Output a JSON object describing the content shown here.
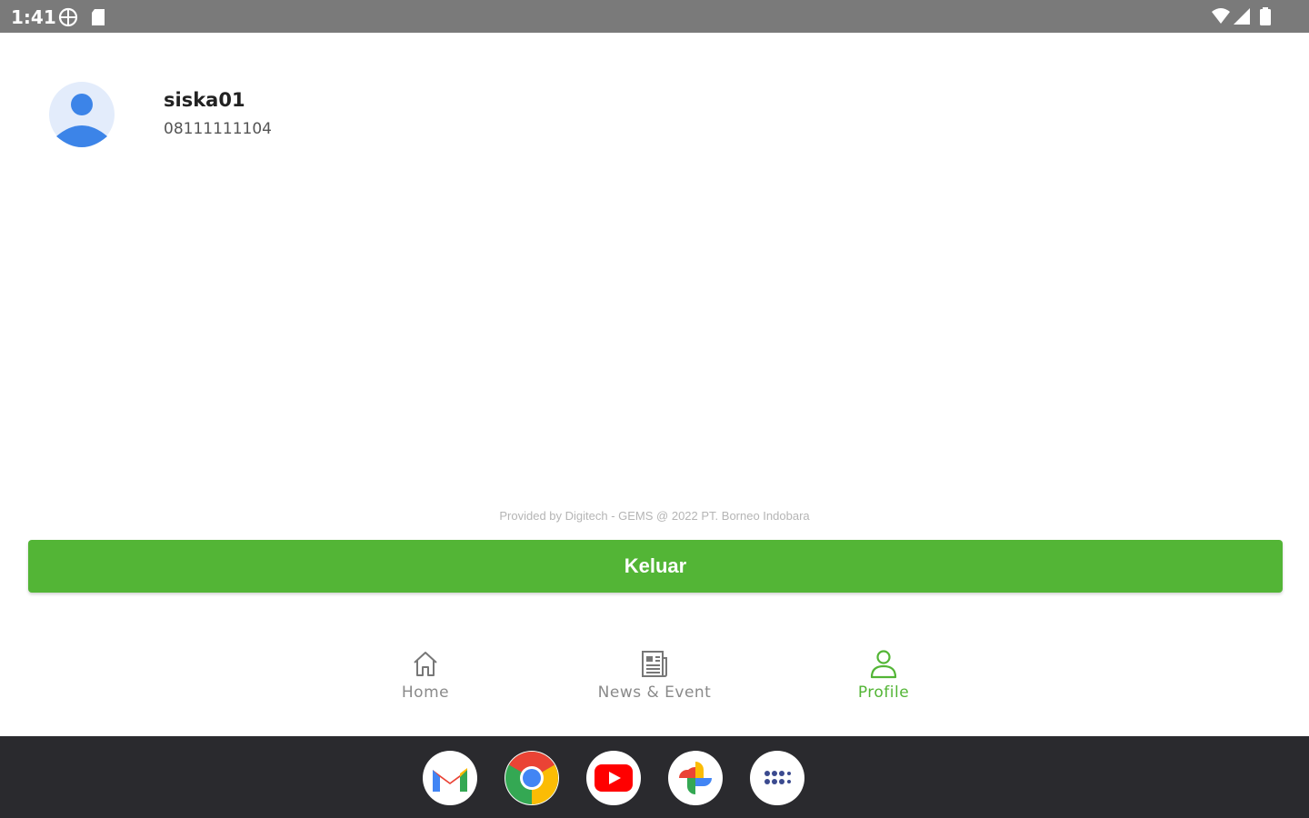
{
  "status_bar": {
    "time": "1:41",
    "icons": [
      "vpn-globe-icon",
      "sd-card-icon",
      "wifi-icon",
      "signal-icon",
      "battery-icon"
    ]
  },
  "profile": {
    "username": "siska01",
    "phone": "08111111104",
    "avatar_icon": "person-avatar-icon"
  },
  "footer": {
    "credit": "Provided by Digitech - GEMS @ 2022 PT. Borneo Indobara"
  },
  "actions": {
    "logout_label": "Keluar"
  },
  "bottom_nav": {
    "items": [
      {
        "label": "Home",
        "icon": "home-icon",
        "active": false
      },
      {
        "label": "News & Event",
        "icon": "newspaper-icon",
        "active": false
      },
      {
        "label": "Profile",
        "icon": "person-icon",
        "active": true
      }
    ]
  },
  "dock": {
    "apps": [
      "gmail-icon",
      "chrome-icon",
      "youtube-icon",
      "photos-icon",
      "app-drawer-icon"
    ]
  },
  "colors": {
    "accent": "#53b536",
    "status_bar": "#7a7a7a",
    "dock": "#2a2a2e",
    "inactive_nav": "#8a8a8a"
  }
}
